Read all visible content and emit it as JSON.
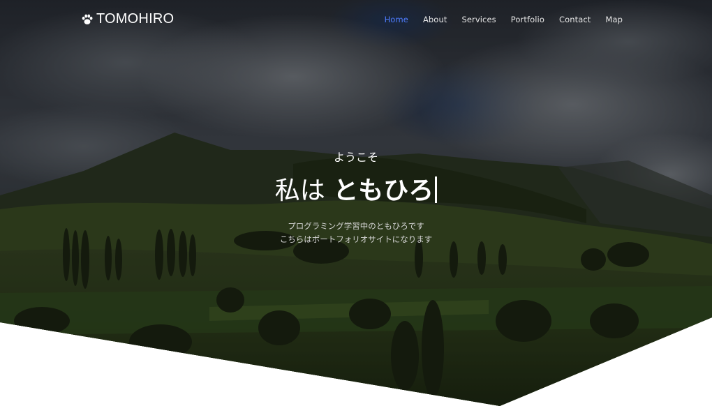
{
  "brand": {
    "name": "TOMOHIRO",
    "icon": "paw-icon"
  },
  "nav": {
    "items": [
      {
        "label": "Home",
        "active": true
      },
      {
        "label": "About",
        "active": false
      },
      {
        "label": "Services",
        "active": false
      },
      {
        "label": "Portfolio",
        "active": false
      },
      {
        "label": "Contact",
        "active": false
      },
      {
        "label": "Map",
        "active": false
      }
    ],
    "active_color": "#4f7dff"
  },
  "hero": {
    "greeting": "ようこそ",
    "headline_prefix": "私は",
    "headline_name": "ともひろ",
    "description_line1": "プログラミング学習中のともひろです",
    "description_line2": "こちらはポートフォリオサイトになります"
  }
}
